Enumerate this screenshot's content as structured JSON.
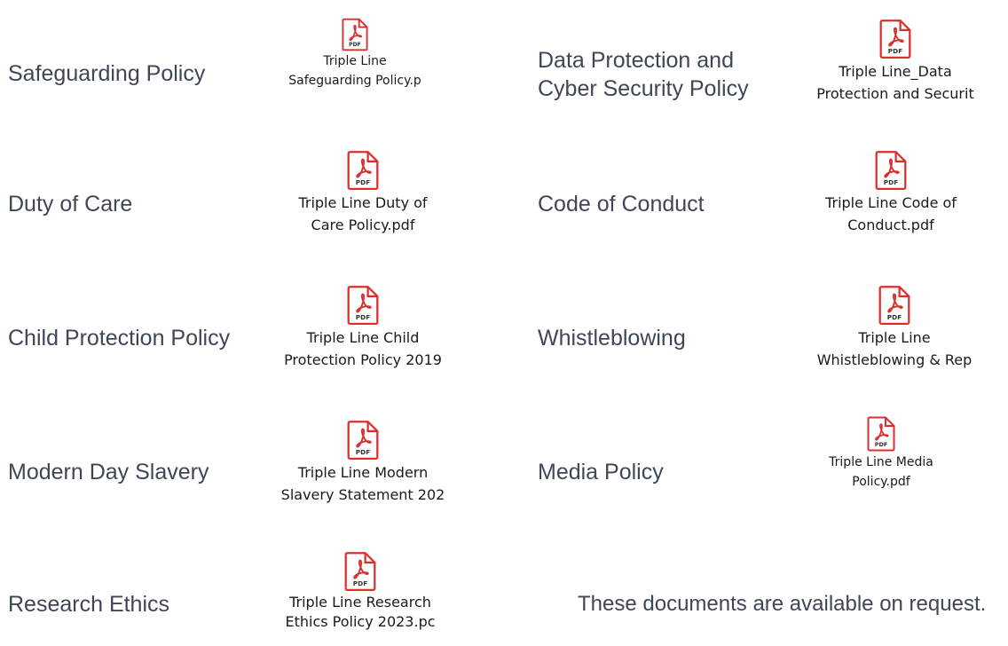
{
  "items": [
    {
      "label": "Safeguarding Policy",
      "file_line1": "Triple Line",
      "file_line2": "Safeguarding Policy.p"
    },
    {
      "label": "Duty of Care",
      "file_line1": "Triple Line Duty of",
      "file_line2": "Care Policy.pdf"
    },
    {
      "label": "Child Protection Policy",
      "file_line1": "Triple Line Child",
      "file_line2": "Protection Policy 2019"
    },
    {
      "label": "Modern Day Slavery",
      "file_line1": "Triple Line Modern",
      "file_line2": "Slavery Statement 202"
    },
    {
      "label": "Research Ethics",
      "file_line1": "Triple Line Research",
      "file_line2": "Ethics Policy 2023.pc"
    },
    {
      "label_line1": "Data Protection and",
      "label_line2": "Cyber Security Policy",
      "file_line1": "Triple Line_Data",
      "file_line2": "Protection and Securit"
    },
    {
      "label": "Code of Conduct",
      "file_line1": "Triple Line Code of",
      "file_line2": "Conduct.pdf"
    },
    {
      "label": "Whistleblowing",
      "file_line1": "Triple Line",
      "file_line2": "Whistleblowing & Rep"
    },
    {
      "label": "Media Policy",
      "file_line1": "Triple Line Media",
      "file_line2": "Policy.pdf"
    }
  ],
  "note": "These documents are available on request.",
  "icon": {
    "name": "pdf-file-icon",
    "text": "PDF",
    "accent": "#d9302c"
  }
}
